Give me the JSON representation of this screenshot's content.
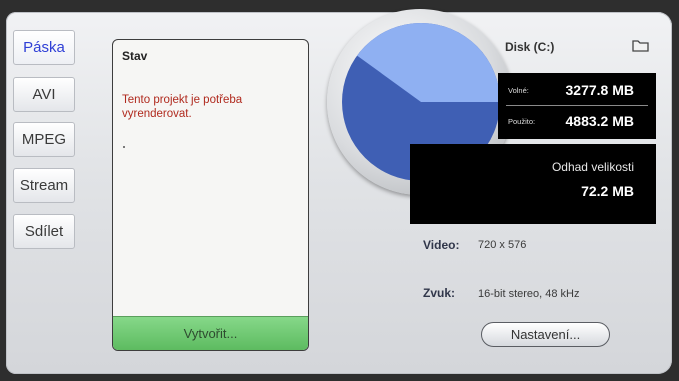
{
  "tabs": [
    {
      "label": "Páska"
    },
    {
      "label": "AVI"
    },
    {
      "label": "MPEG"
    },
    {
      "label": "Stream"
    },
    {
      "label": "Sdílet"
    }
  ],
  "status": {
    "title": "Stav",
    "message": "Tento projekt je potřeba vyrenderovat."
  },
  "create_button": "Vytvořit...",
  "disk": {
    "label": "Disk (C:)",
    "free_label": "Volné:",
    "free_value": "3277.8 MB",
    "used_label": "Použito:",
    "used_value": "4883.2 MB",
    "free_fraction": 0.4,
    "free_color": "#8fb0f2",
    "used_color": "#3f5fb4"
  },
  "estimate": {
    "label": "Odhad velikosti",
    "value": "72.2 MB"
  },
  "info": {
    "video_label": "Video:",
    "video_value": "720 x 576",
    "audio_label": "Zvuk:",
    "audio_value": "16-bit stereo, 48 kHz"
  },
  "settings_button": "Nastavení..."
}
